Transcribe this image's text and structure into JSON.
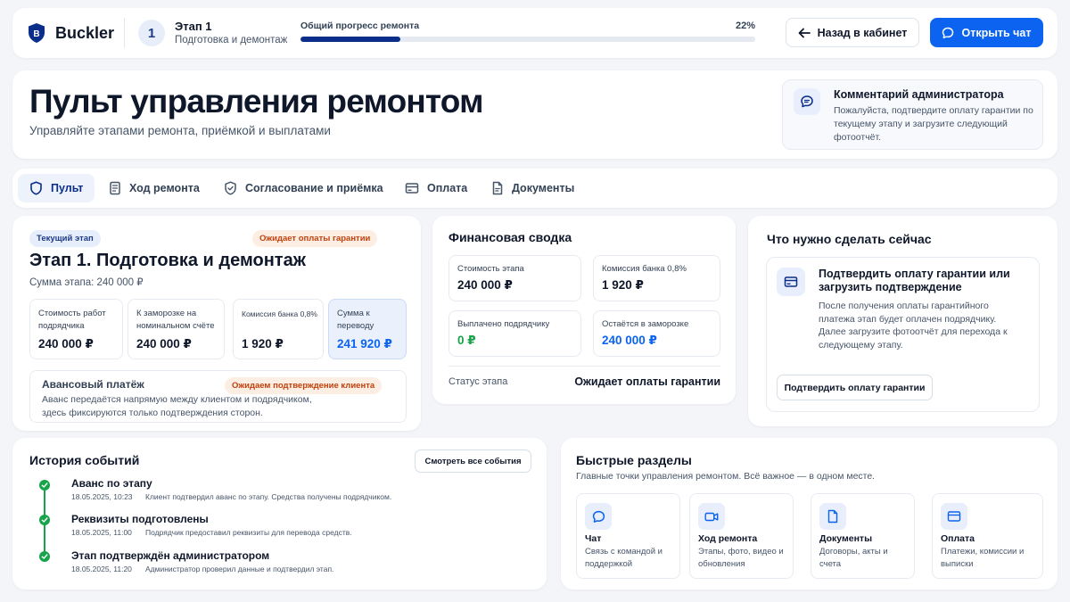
{
  "header": {
    "brand": "Buckler",
    "stage_number": "1",
    "stage_title": "Этап 1",
    "stage_subtitle": "Подготовка и демонтаж",
    "progress_label": "Общий прогресс ремонта",
    "progress_text": "22%",
    "progress_value": 0.22,
    "back_button": "Назад в кабинет",
    "chat_button": "Открыть чат"
  },
  "page": {
    "title": "Пульт управления ремонтом",
    "subtitle": "Управляйте этапами ремонта, приёмкой и выплатами"
  },
  "admin_comment": {
    "title": "Комментарий администратора",
    "text": "Пожалуйста, подтвердите оплату гарантии по текущему этапу и загрузите следующий фотоотчёт."
  },
  "tabs": [
    {
      "label": "Пульт",
      "icon": "shield-icon",
      "active": true
    },
    {
      "label": "Ход ремонта",
      "icon": "document-icon",
      "active": false
    },
    {
      "label": "Согласование и приёмка",
      "icon": "shield-check-icon",
      "active": false
    },
    {
      "label": "Оплата",
      "icon": "card-icon",
      "active": false
    },
    {
      "label": "Документы",
      "icon": "file-icon",
      "active": false
    }
  ],
  "current_stage": {
    "badge": "Текущий этап",
    "status": "Ожидает оплаты гарантии",
    "title": "Этап 1. Подготовка и демонтаж",
    "sum": "Сумма этапа: 240 000 ₽",
    "metrics": [
      {
        "label": "Стоимость работ подрядчика",
        "value": "240 000 ₽"
      },
      {
        "label": "К заморозке на номинальном счёте",
        "value": "240 000 ₽"
      },
      {
        "label": "Комиссия банка 0,8%",
        "value": "1 920 ₽"
      },
      {
        "label": "Сумма к переводу",
        "value": "241 920 ₽"
      }
    ],
    "advance": {
      "title": "Авансовый платёж",
      "status": "Ожидаем подтверждение клиента",
      "text": "Аванс передаётся напрямую между клиентом и подрядчиком, здесь фиксируются только подтверждения сторон."
    }
  },
  "finance": {
    "title": "Финансовая сводка",
    "items": [
      {
        "label": "Стоимость этапа",
        "value": "240 000 ₽"
      },
      {
        "label": "Комиссия банка 0,8%",
        "value": "1 920 ₽"
      },
      {
        "label": "Выплачено подрядчику",
        "value": "0 ₽"
      },
      {
        "label": "Остаётся в заморозке",
        "value": "240 000 ₽"
      }
    ],
    "status_label": "Статус этапа",
    "status_value": "Ожидает оплаты гарантии"
  },
  "todo": {
    "title": "Что нужно сделать сейчас",
    "task_title": "Подтвердить оплату гарантии или загрузить подтверждение",
    "task_text": "После получения оплаты гарантийного платежа этап будет оплачен подрядчику. Далее загрузите фотоотчёт для перехода к следующему этапу.",
    "button": "Подтвердить оплату гарантии"
  },
  "history": {
    "title": "История событий",
    "button": "Смотреть все события",
    "events": [
      {
        "title": "Аванс по этапу",
        "date": "18.05.2025,  10:23",
        "text": "Клиент подтвердил аванс по этапу. Средства получены подрядчиком."
      },
      {
        "title": "Реквизиты подготовлены",
        "date": "18.05.2025, 11:00",
        "text": "Подрядчик предоставил реквизиты для перевода средств."
      },
      {
        "title": "Этап подтверждён администратором",
        "date": "18.05.2025, 11:20",
        "text": "Администратор проверил данные и подтвердил этап."
      }
    ]
  },
  "quick": {
    "title": "Быстрые разделы",
    "subtitle": "Главные точки управления ремонтом. Всё важное — в одном месте.",
    "items": [
      {
        "title": "Чат",
        "text": "Связь с командой и поддержкой",
        "icon": "chat-icon"
      },
      {
        "title": "Ход ремонта",
        "text": "Этапы, фото, видео и обновления",
        "icon": "video-icon"
      },
      {
        "title": "Документы",
        "text": "Договоры, акты и счета",
        "icon": "file-icon"
      },
      {
        "title": "Оплата",
        "text": "Платежи, комиссии и выписки",
        "icon": "card-icon"
      }
    ]
  },
  "colors": {
    "accent": "#0b63f0",
    "navy": "#0b2e8a",
    "success": "#16a34a",
    "warning": "#c2410c",
    "warning_bg": "#fdeee3"
  }
}
